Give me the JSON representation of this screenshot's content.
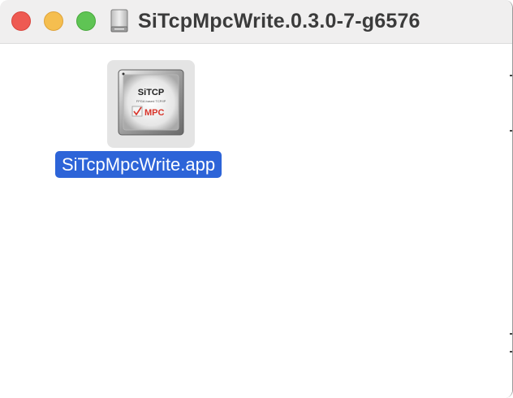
{
  "window": {
    "title": "SiTcpMpcWrite.0.3.0-7-g6576",
    "title_icon": "disk-image-icon"
  },
  "traffic_lights": {
    "close_color": "#ee5a52",
    "minimize_color": "#f5be4f",
    "maximize_color": "#5fc454"
  },
  "files": [
    {
      "name": "SiTcpMpcWrite.app",
      "icon": "sitcp-mpc-app-icon",
      "icon_text": {
        "brand": "SiTCP",
        "tagline": "FPGA based TCP/IP",
        "product": "MPC"
      },
      "selected": true
    }
  ],
  "colors": {
    "selection": "#2d64d8",
    "product_red": "#d8342a"
  }
}
